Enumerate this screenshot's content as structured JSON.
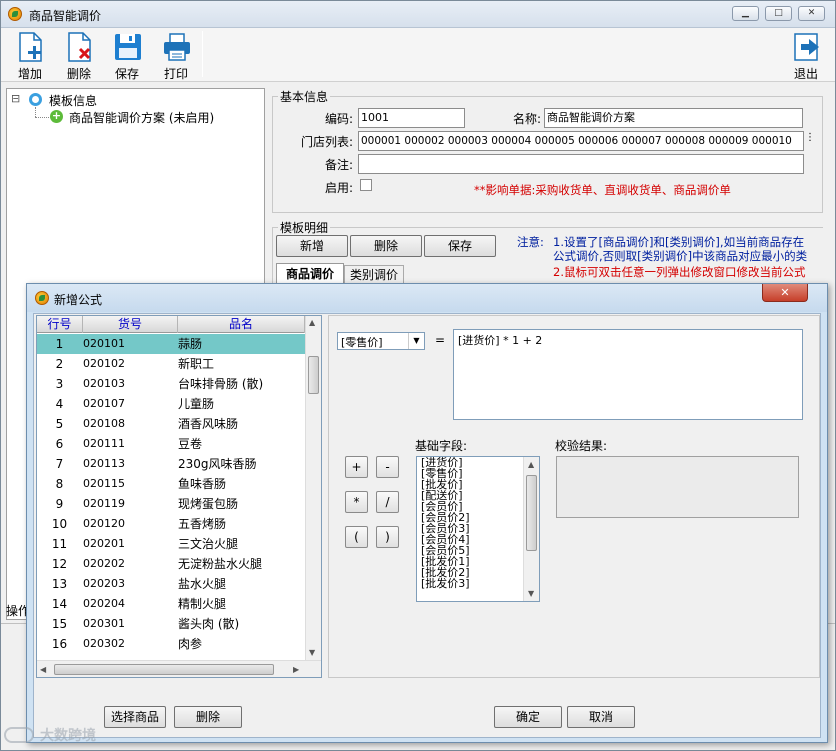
{
  "main_window": {
    "title": "商品智能调价",
    "controls": [
      "▁",
      "□",
      "✕"
    ]
  },
  "toolbar": {
    "add_label": "增加",
    "delete_label": "删除",
    "save_label": "保存",
    "print_label": "打印",
    "exit_label": "退出"
  },
  "tree": {
    "root_label": "模板信息",
    "child_label": "商品智能调价方案 (未启用)",
    "expander": "⊟"
  },
  "basic_info": {
    "title": "基本信息",
    "code_label": "编码:",
    "code_value": "1001",
    "name_label": "名称:",
    "name_value": "商品智能调价方案",
    "stores_label": "门店列表:",
    "stores_value": "000001 000002 000003 000004 000005 000006 000007 000008 000009 000010",
    "note_label": "备注:",
    "note_value": "",
    "enabled_label": "启用:",
    "impact_text": "**影响单据:采购收货单、直调收货单、商品调价单"
  },
  "template_detail": {
    "title": "模板明细",
    "new_label": "新增",
    "delete_label": "删除",
    "save_label": "保存",
    "tabs": [
      "商品调价",
      "类别调价"
    ],
    "note_label": "注意:",
    "note_line1": "1.设置了[商品调价]和[类别调价],如当前商品存在",
    "note_line2": "公式调价,否则取[类别调价]中该商品对应最小的类",
    "note_line3": "2.鼠标可双击任意一列弹出修改窗口修改当前公式"
  },
  "status_bar": {
    "text": "操作"
  },
  "dialog": {
    "title": "新增公式",
    "close_label": "✕",
    "grid_headers": [
      "行号",
      "货号",
      "品名"
    ],
    "grid_rows": [
      {
        "no": "1",
        "code": "020101",
        "name": "蒜肠"
      },
      {
        "no": "2",
        "code": "020102",
        "name": "新职工"
      },
      {
        "no": "3",
        "code": "020103",
        "name": "台味排骨肠 (散)"
      },
      {
        "no": "4",
        "code": "020107",
        "name": "儿童肠"
      },
      {
        "no": "5",
        "code": "020108",
        "name": "酒香风味肠"
      },
      {
        "no": "6",
        "code": "020111",
        "name": "豆卷"
      },
      {
        "no": "7",
        "code": "020113",
        "name": "230g风味香肠"
      },
      {
        "no": "8",
        "code": "020115",
        "name": "鱼味香肠"
      },
      {
        "no": "9",
        "code": "020119",
        "name": "现烤蛋包肠"
      },
      {
        "no": "10",
        "code": "020120",
        "name": "五香烤肠"
      },
      {
        "no": "11",
        "code": "020201",
        "name": "三文治火腿"
      },
      {
        "no": "12",
        "code": "020202",
        "name": "无淀粉盐水火腿"
      },
      {
        "no": "13",
        "code": "020203",
        "name": "盐水火腿"
      },
      {
        "no": "14",
        "code": "020204",
        "name": "精制火腿"
      },
      {
        "no": "15",
        "code": "020301",
        "name": "酱头肉 (散)"
      },
      {
        "no": "16",
        "code": "020302",
        "name": "肉参"
      }
    ],
    "selected_row": 0,
    "price_field_value": "[零售价]",
    "equals": "=",
    "formula_text": "[进货价] * 1 + 2",
    "operators": [
      "+",
      "-",
      "*",
      "/",
      "(",
      ")"
    ],
    "base_fields_label": "基础字段:",
    "base_fields": [
      "[进货价]",
      "[零售价]",
      "[批发价]",
      "[配送价]",
      "[会员价]",
      "[会员价2]",
      "[会员价3]",
      "[会员价4]",
      "[会员价5]",
      "[批发价1]",
      "[批发价2]",
      "[批发价3]"
    ],
    "check_result_label": "校验结果:",
    "check_result_value": "",
    "select_product_label": "选择商品",
    "delete_label": "删除",
    "ok_label": "确定",
    "cancel_label": "取消"
  },
  "watermark": {
    "text": "大数跨境"
  },
  "colors": {
    "selected_row": "#74c8c8",
    "dialog_frame": "#cfe2f3",
    "close_button": "#c94a36",
    "notice_red": "#d40000",
    "notice_blue": "#00209f"
  }
}
